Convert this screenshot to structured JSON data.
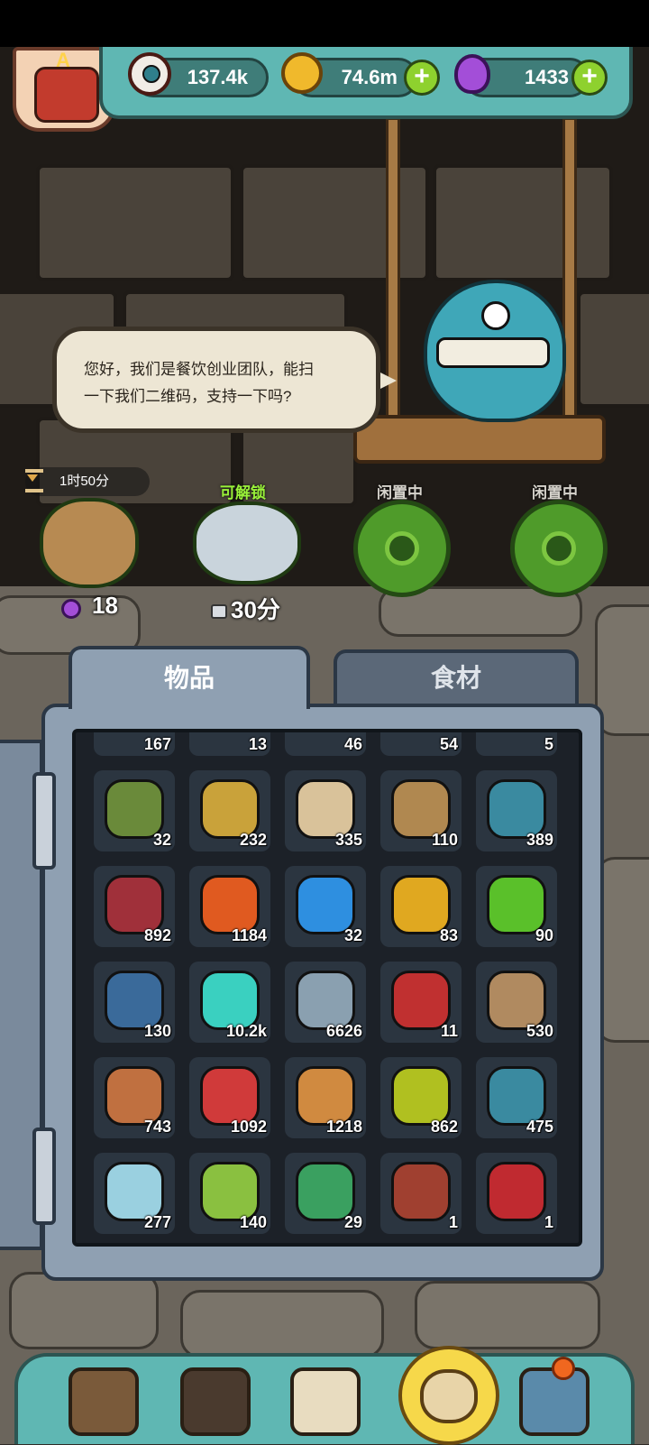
{
  "header": {
    "resources": [
      {
        "icon": "eyeball-icon",
        "value": "137.4k",
        "has_add": false
      },
      {
        "icon": "gold-coin-icon",
        "value": "74.6m",
        "has_add": true
      },
      {
        "icon": "purple-potion-icon",
        "value": "1433",
        "has_add": true
      }
    ],
    "rank_letter": "A"
  },
  "dialog": {
    "line1": "您好，我们是餐饮创业团队，能扫",
    "line2": "一下我们二维码，支持一下吗?"
  },
  "slots": [
    {
      "top_label": "1时50分",
      "bottom_label": "18",
      "bottom_icon": "potion-icon"
    },
    {
      "top_label": "可解锁",
      "bottom_label": "30分",
      "bottom_icon": "lock-icon"
    },
    {
      "top_label": "闲置中",
      "bottom_label": ""
    },
    {
      "top_label": "闲置中",
      "bottom_label": ""
    }
  ],
  "tabs": {
    "items": "物品",
    "ingredients": "食材"
  },
  "inventory": {
    "partial_row": [
      "167",
      "13",
      "46",
      "54",
      "5"
    ],
    "rows": [
      [
        "32",
        "232",
        "335",
        "110",
        "389"
      ],
      [
        "892",
        "1184",
        "32",
        "83",
        "90"
      ],
      [
        "130",
        "10.2k",
        "6626",
        "11",
        "530"
      ],
      [
        "743",
        "1092",
        "1218",
        "862",
        "475"
      ],
      [
        "277",
        "140",
        "29",
        "1",
        "1"
      ]
    ],
    "colors": [
      [
        "#6a8a3a",
        "#c9a23a",
        "#d9c29a",
        "#b08850",
        "#3a8aa0"
      ],
      [
        "#a0303a",
        "#e05a20",
        "#2e8fe0",
        "#e0a820",
        "#5ac02a"
      ],
      [
        "#3a6a9a",
        "#3ad0c0",
        "#8aa0b0",
        "#c03030",
        "#b08a60"
      ],
      [
        "#c07040",
        "#d03a3a",
        "#d08a40",
        "#b0c020",
        "#3a8aa0"
      ],
      [
        "#9ad0e0",
        "#8ac040",
        "#3aa060",
        "#a04030",
        "#c02a30"
      ]
    ]
  },
  "bottom_nav": [
    "shop-icon",
    "monster-hut-icon",
    "recipe-book-icon",
    "item-bag-icon",
    "collection-grid-icon"
  ]
}
